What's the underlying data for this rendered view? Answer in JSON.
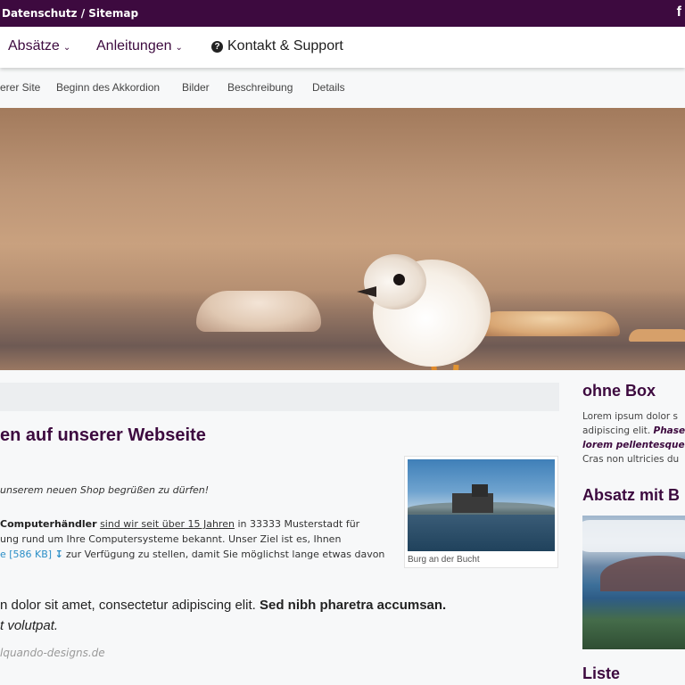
{
  "topbar": {
    "links": "Datenschutz / Sitemap",
    "facebook_label": "f"
  },
  "mainnav": {
    "items": [
      {
        "label": "Absätze"
      },
      {
        "label": "Anleitungen"
      },
      {
        "label": "Kontakt & Support"
      }
    ]
  },
  "subnav": {
    "items": [
      "erer Site",
      "Beginn des Akkordion",
      "Bilder",
      "Beschreibung",
      "Details"
    ]
  },
  "main": {
    "heading": "en auf unserer Webseite",
    "intro_italic": "unserem neuen Shop begrüßen zu dürfen!",
    "para": {
      "bold_start": "Computerhändler",
      "underlined": "sind wir seit über 15 Jahren",
      "rest1": "in 33333 Musterstadt für",
      "line2": "ung rund um Ihre Computersysteme bekannt. Unser Ziel ist es, Ihnen",
      "link_text": "e [586 KB]",
      "line3_rest": "zur Verfügung zu stellen, damit Sie möglichst lange etwas davon"
    },
    "figure_caption": "Burg an der Bucht",
    "lead": {
      "normal": "n dolor sit amet, consectetur adipiscing elit.",
      "bold": "Sed nibh pharetra accumsan.",
      "italic": "t volutpat."
    },
    "author": "lquando-designs.de"
  },
  "sidebar": {
    "heading1": "ohne Box",
    "text_line1": "Lorem ipsum dolor s",
    "text_line2_normal": "adipiscing elit.",
    "text_line2_bold": "Phase",
    "text_line3_bold": "lorem pellentesque i",
    "text_line4": "Cras non ultricies du",
    "heading2": "Absatz mit B",
    "heading3": "Liste"
  },
  "colors": {
    "brand": "#3d0a3f",
    "link": "#2a8ec7"
  }
}
